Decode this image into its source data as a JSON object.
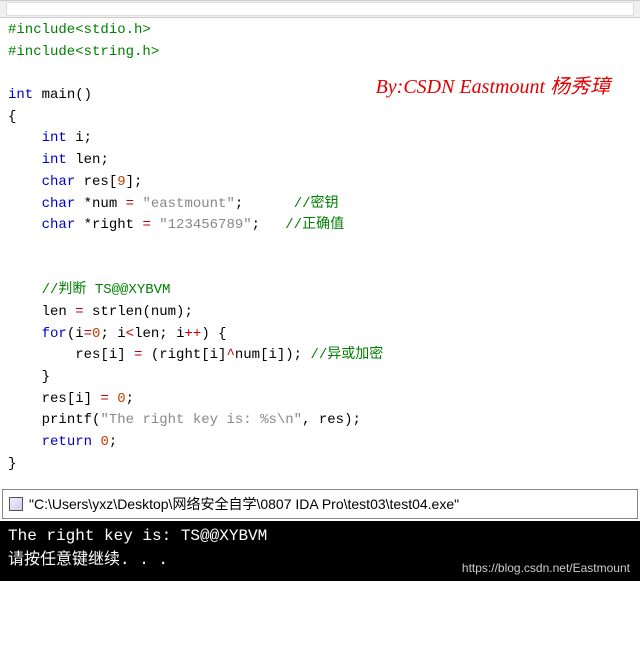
{
  "watermark": "By:CSDN Eastmount  杨秀璋",
  "code": {
    "l1_inc1": "#include",
    "l1_hdr1": "<stdio.h>",
    "l2_inc2": "#include",
    "l2_hdr2": "<string.h>",
    "l4_int": "int",
    "l4_main": " main",
    "l4_paren": "()",
    "l5_brace": "{",
    "l6_int": "int",
    "l6_i": " i",
    "l7_int": "int",
    "l7_len": " len",
    "l8_char": "char",
    "l8_res": " res",
    "l8_9": "9",
    "l9_char": "char",
    "l9_num": " *num ",
    "l9_eq": "=",
    "l9_str": " \"eastmount\"",
    "l9_cmt": "//密钥",
    "l10_char": "char",
    "l10_right": " *right ",
    "l10_eq": "=",
    "l10_str": " \"123456789\"",
    "l10_cmt": "//正确值",
    "l13_cmt": "//判断 TS@@XYBVM",
    "l14_len": "len ",
    "l14_eq": "=",
    "l14_strlen": " strlen",
    "l14_num": "(num)",
    "l15_for": "for",
    "l15_i": "(i",
    "l15_eq": "=",
    "l15_0": "0",
    "l15_semi": "; i",
    "l15_lt": "<",
    "l15_len": "len; i",
    "l15_pp": "++",
    "l15_end": ") {",
    "l16_res": "res[i] ",
    "l16_eq": "=",
    "l16_expr1": " (right[i]",
    "l16_xor": "^",
    "l16_expr2": "num[i]); ",
    "l16_cmt": "//异或加密",
    "l17_brace": "}",
    "l18_res": "res[i] ",
    "l18_eq": "=",
    "l18_sp": " ",
    "l18_0": "0",
    "l19_printf": "printf",
    "l19_open": "(",
    "l19_str": "\"The right key is: %s\\n\"",
    "l19_end": ", res)",
    "l20_return": "return",
    "l20_sp": " ",
    "l20_0": "0",
    "l21_brace": "}"
  },
  "pathbar": "\"C:\\Users\\yxz\\Desktop\\网络安全自学\\0807 IDA Pro\\test03\\test04.exe\"",
  "console": {
    "line1": "The right key is: TS@@XYBVM",
    "line2": "请按任意键继续. . .",
    "url": "https://blog.csdn.net/Eastmount"
  }
}
